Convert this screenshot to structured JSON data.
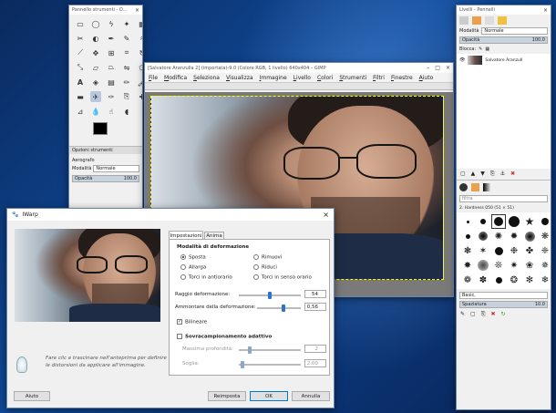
{
  "toolbox": {
    "title": "Pannello strumenti - O...",
    "options_tab": "Opzioni strumenti",
    "tool_name": "Aerografo",
    "mode_label": "Modalità",
    "mode_value": "Normale",
    "opacity_label": "Opacità",
    "opacity_value": "100.0"
  },
  "image_window": {
    "title": "[Salvatore Aranzulla 2] (importata)-9.0 (Colore RGB, 1 livello) 640x404 – GIMP",
    "menu": [
      "File",
      "Modifica",
      "Seleziona",
      "Visualizza",
      "Immagine",
      "Livello",
      "Colori",
      "Strumenti",
      "Filtri",
      "Finestre",
      "Aiuto"
    ]
  },
  "layers": {
    "title": "Livelli - Pennelli",
    "mode_label": "Modalità",
    "mode_value": "Normale",
    "opacity_label": "Opacità",
    "opacity_value": "100.0",
    "lock_label": "Blocca:",
    "layer_name": "Salvatore Aranzull",
    "filter_placeholder": "filtra",
    "brush_name": "2. Hardness 050 (51 × 51)",
    "brush_tag": "Basic,",
    "spacing_label": "Spaziatura",
    "spacing_value": "10.0"
  },
  "dialog": {
    "title": "IWarp",
    "tabs": [
      "Impostazioni",
      "Anima"
    ],
    "section_mode": "Modalità di deformazione",
    "modes": [
      "Sposta",
      "Rimuovi",
      "Allarga",
      "Riduci",
      "Torci in antiorario",
      "Torci in senso orario"
    ],
    "radius_label": "Raggio deformazione:",
    "radius_value": "54",
    "amount_label": "Ammontare della deformazione:",
    "amount_value": "0,56",
    "bilinear_label": "Bilineare",
    "supersample_label": "Sovracampionamento adattivo",
    "max_depth_label": "Massima profondità:",
    "max_depth_value": "2",
    "threshold_label": "Soglia:",
    "threshold_value": "2,00",
    "hint": "Fare clic e trascinare nell'anteprima per definire le distorsioni da applicare all'immagine.",
    "help_btn": "Aiuto",
    "reset_btn": "Reimposta",
    "ok_btn": "OK",
    "cancel_btn": "Annulla"
  }
}
